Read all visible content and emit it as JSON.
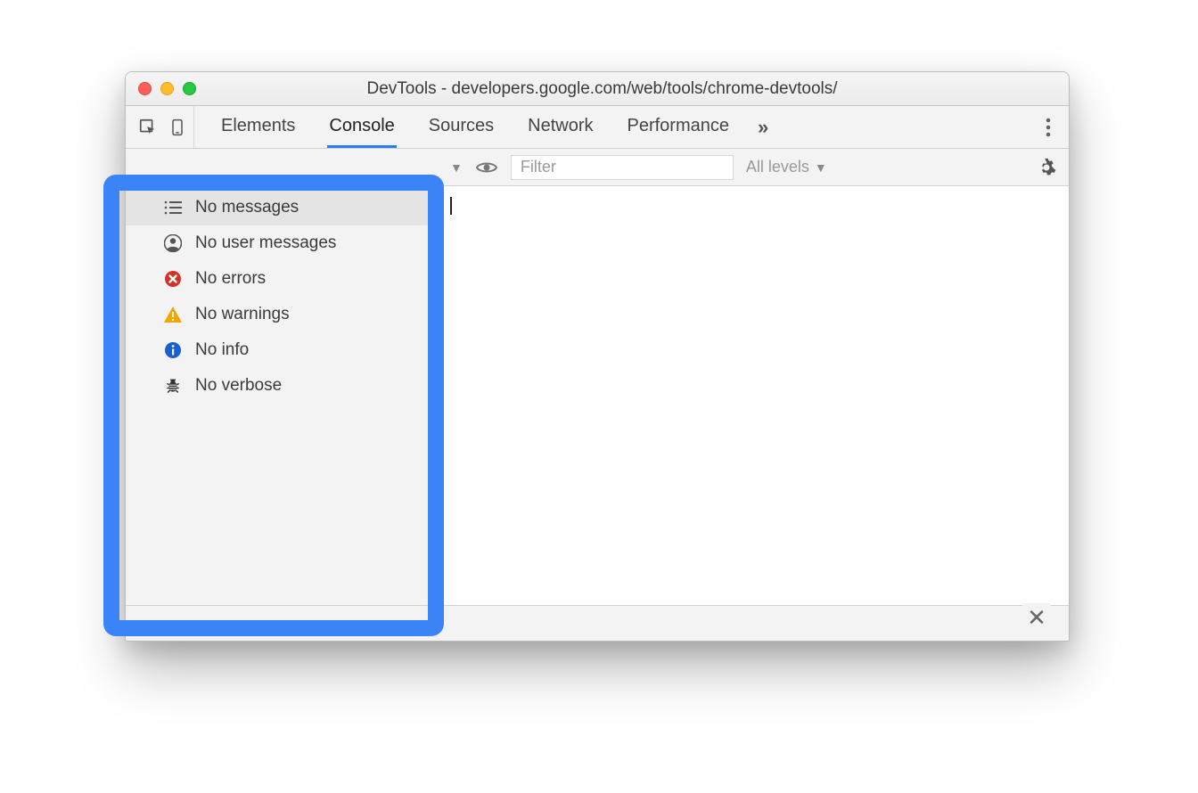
{
  "window": {
    "title": "DevTools - developers.google.com/web/tools/chrome-devtools/"
  },
  "tabs": {
    "items": [
      "Elements",
      "Console",
      "Sources",
      "Network",
      "Performance"
    ],
    "active_index": 1,
    "more_glyph": "»"
  },
  "filterbar": {
    "placeholder": "Filter",
    "levels_label": "All levels"
  },
  "sidebar": {
    "items": [
      {
        "icon": "list",
        "label": "No messages",
        "selected": true
      },
      {
        "icon": "user",
        "label": "No user messages",
        "selected": false
      },
      {
        "icon": "error",
        "label": "No errors",
        "selected": false
      },
      {
        "icon": "warning",
        "label": "No warnings",
        "selected": false
      },
      {
        "icon": "info",
        "label": "No info",
        "selected": false
      },
      {
        "icon": "bug",
        "label": "No verbose",
        "selected": false
      }
    ]
  },
  "colors": {
    "accent": "#3b84f8",
    "error": "#d93025",
    "warning": "#f2a600",
    "info": "#1a5fd0"
  }
}
